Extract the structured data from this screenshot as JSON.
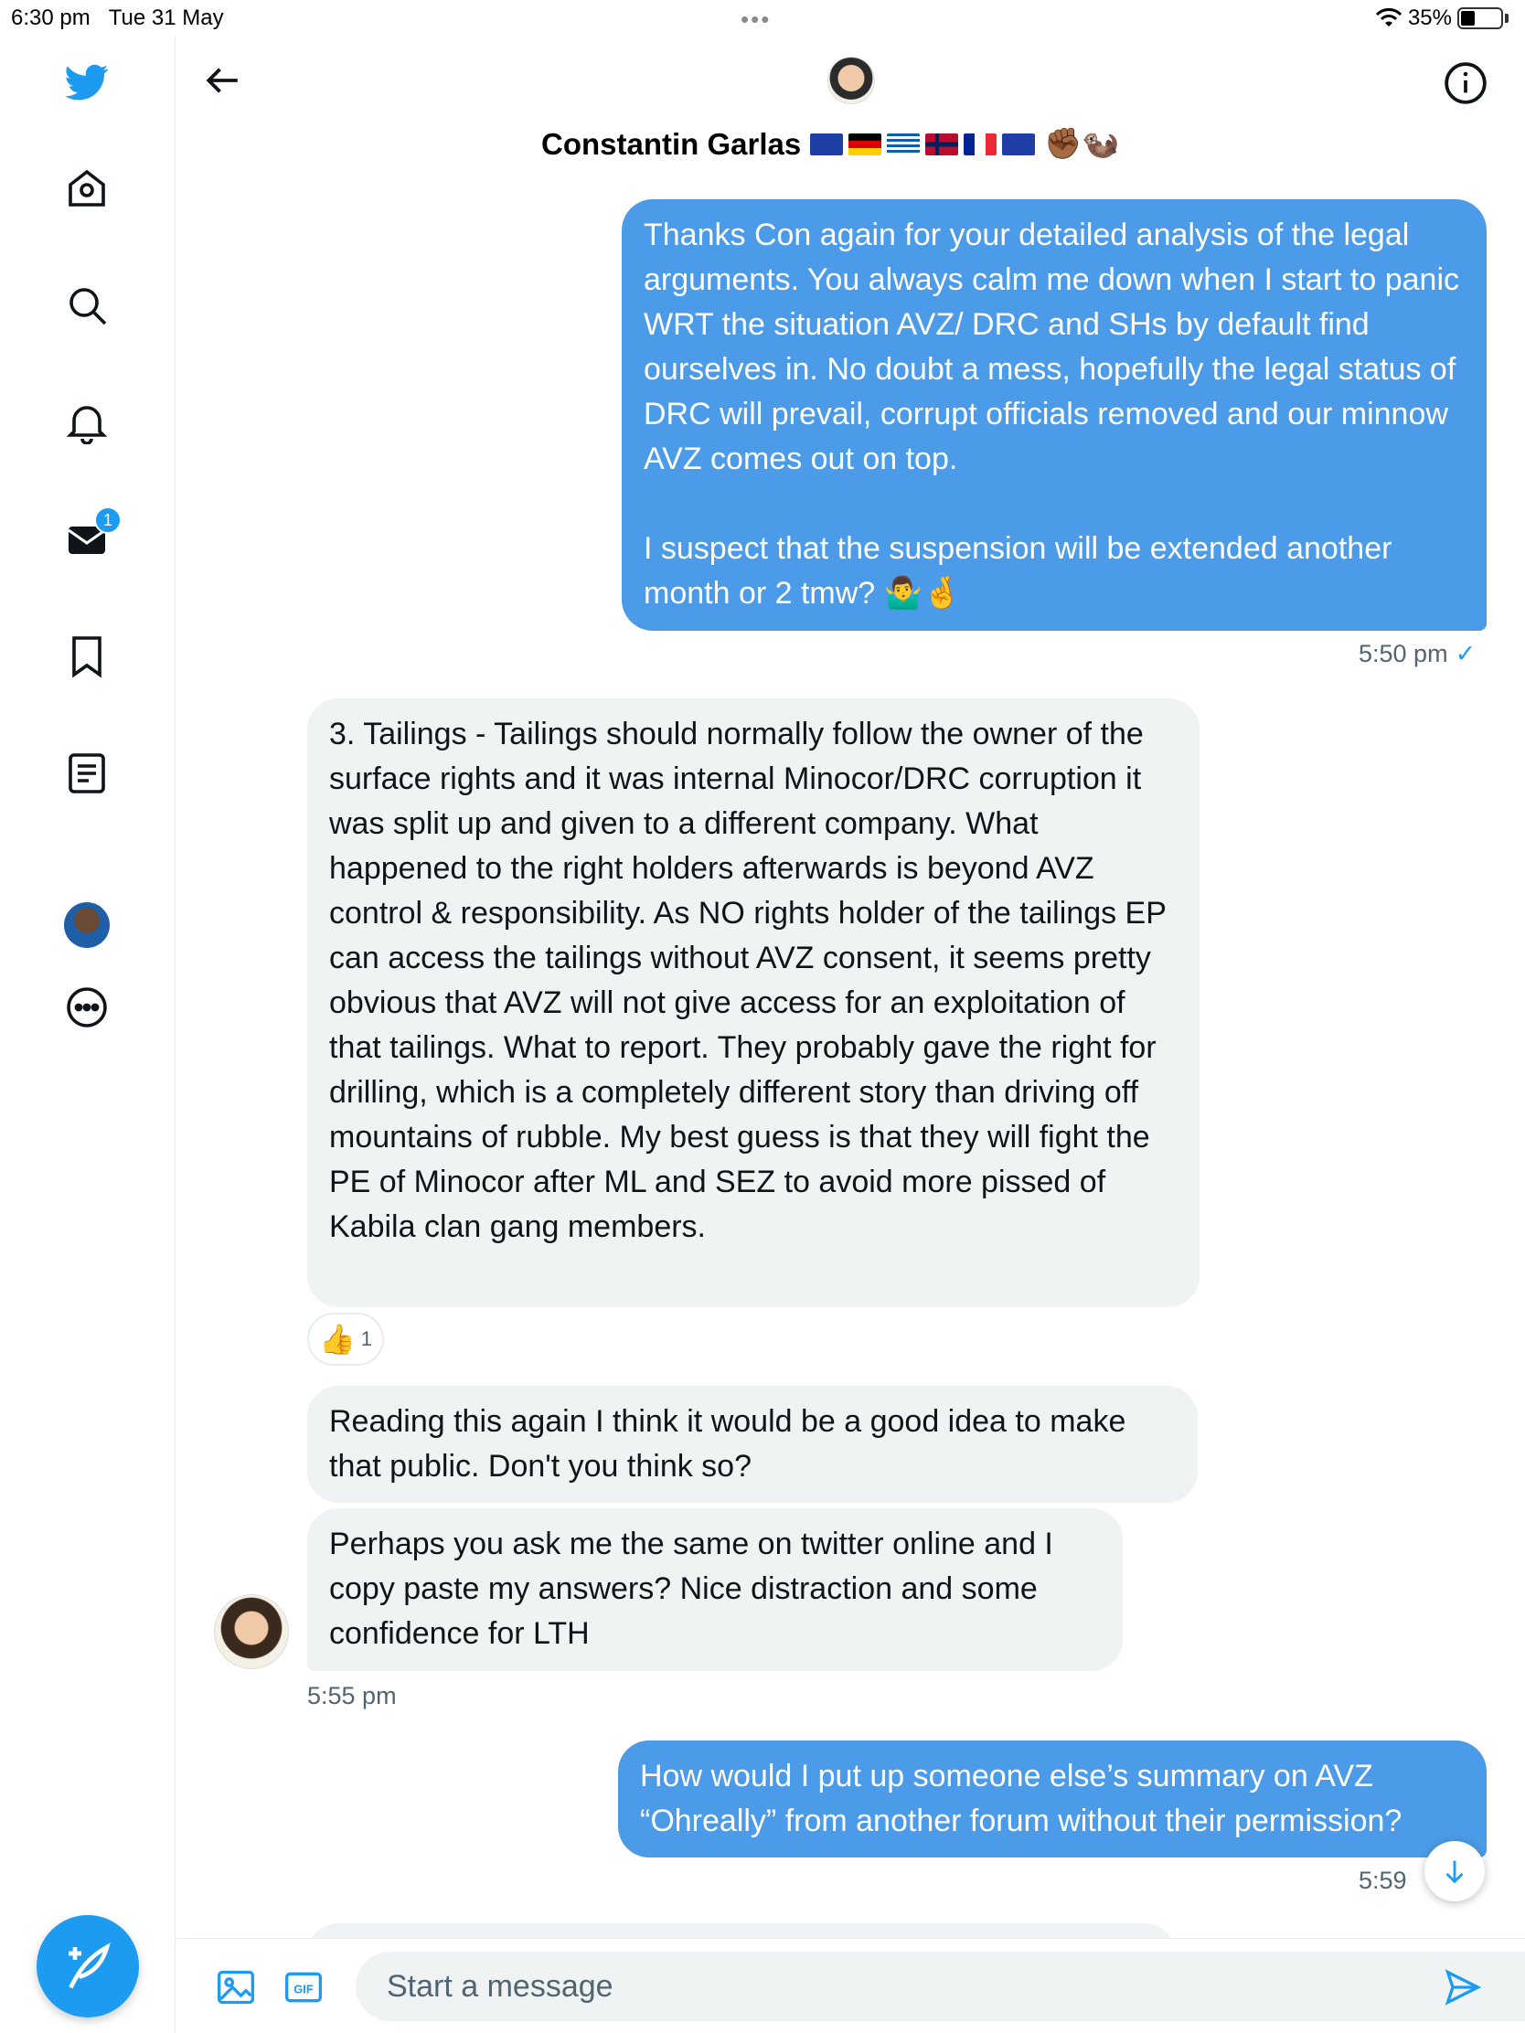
{
  "status_bar": {
    "time": "6:30 pm",
    "date": "Tue 31 May",
    "battery": "35%",
    "battery_fraction": 0.35
  },
  "sidebar": {
    "items": [
      {
        "name": "twitter-logo",
        "icon": "twitter-bird-icon"
      },
      {
        "name": "home",
        "icon": "home-icon"
      },
      {
        "name": "explore",
        "icon": "search-icon"
      },
      {
        "name": "notifications",
        "icon": "bell-icon"
      },
      {
        "name": "messages",
        "icon": "envelope-icon",
        "badge": "1"
      },
      {
        "name": "bookmarks",
        "icon": "bookmark-icon"
      },
      {
        "name": "lists",
        "icon": "list-icon"
      },
      {
        "name": "profile",
        "icon": "avatar"
      },
      {
        "name": "more",
        "icon": "more-icon"
      }
    ],
    "accent": "#1d9bf0"
  },
  "header": {
    "name": "Constantin Garlas",
    "emoji_suffix": "✊🏾🦦"
  },
  "messages": [
    {
      "direction": "sent",
      "text": "Thanks Con again for your detailed analysis of the legal arguments. You always calm me down when I start to panic WRT the situation AVZ/ DRC and SHs by default find ourselves in. No doubt a mess, hopefully the legal status of DRC will prevail, corrupt officials removed and our minnow AVZ comes out on top.\n\nI suspect that the suspension will be extended another month or 2 tmw? 🤷‍♂️🤞",
      "time": "5:50 pm",
      "read_mark": "✓"
    },
    {
      "direction": "received",
      "text": "3. Tailings - Tailings should normally follow the owner of the surface rights and it was internal Minocor/DRC corruption it was split up and given to a different company. What happened to the right holders afterwards is beyond AVZ control & responsibility. As NO rights holder of the tailings EP can access the tailings without AVZ consent, it seems pretty obvious that AVZ will not give access for an exploitation of that tailings. What to report. They probably gave the right for drilling, which is a completely different story than driving off mountains of rubble. My best guess is that they will fight the PE of Minocor after ML and SEZ to avoid more pissed of Kabila clan gang members.",
      "reaction": {
        "emoji": "👍",
        "count": "1"
      }
    },
    {
      "direction": "received",
      "text": "Reading this again I think it would be a good idea to make that public. Don't you think so?"
    },
    {
      "direction": "received",
      "text": "Perhaps you ask me the same on twitter online and I copy paste my answers? Nice distraction and some confidence for LTH",
      "time": "5:55 pm"
    },
    {
      "direction": "sent",
      "text": "How would I put up someone else’s summary on AVZ “Ohreally” from another forum without their permission?",
      "time": "5:59"
    }
  ],
  "composer": {
    "placeholder": "Start a message"
  },
  "colors": {
    "sent_bubble": "#4c9be8",
    "received_bubble": "#eff3f4",
    "accent": "#1d9bf0"
  }
}
